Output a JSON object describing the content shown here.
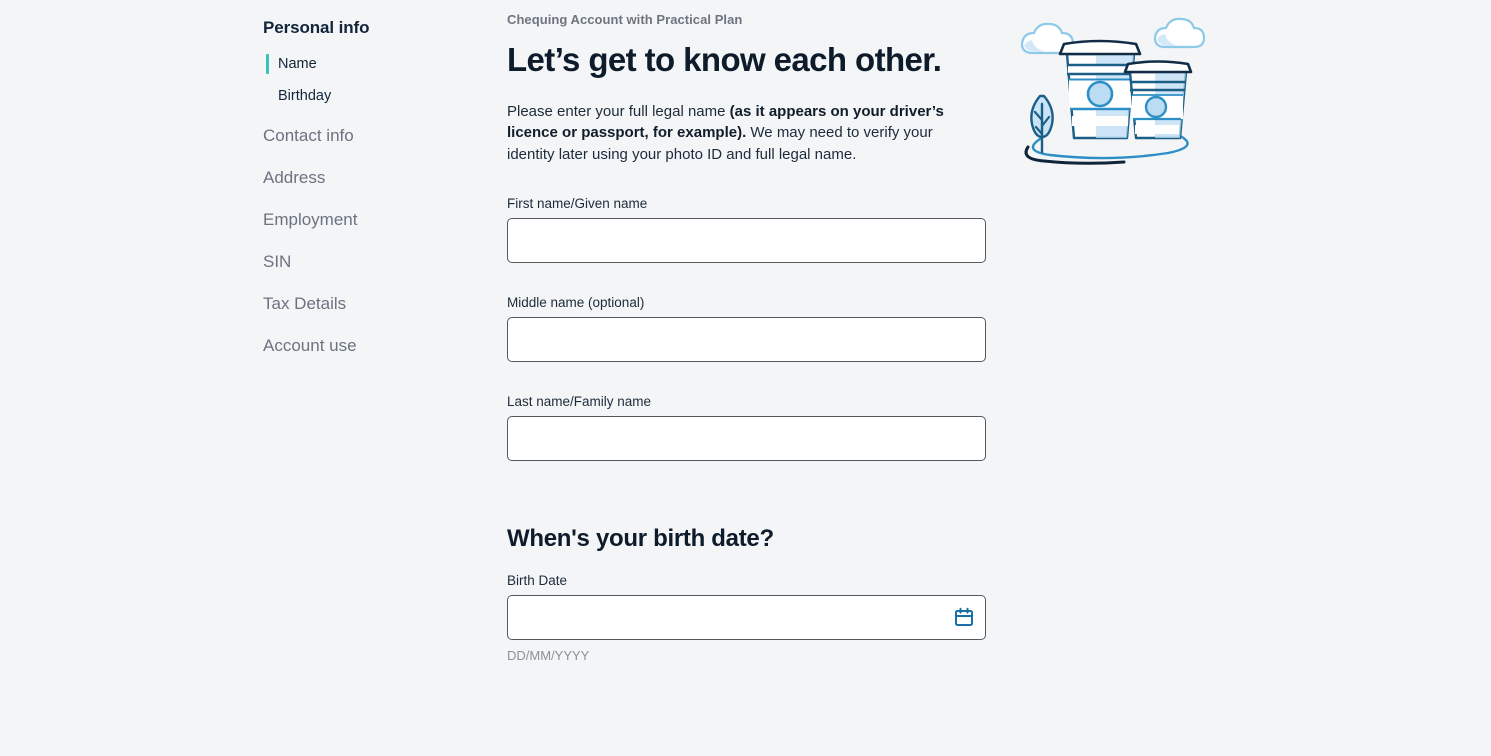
{
  "sidebar": {
    "heading": "Personal info",
    "sub_items": [
      {
        "label": "Name",
        "active": true
      },
      {
        "label": "Birthday",
        "active": false
      }
    ],
    "nav_items": [
      {
        "label": "Contact info"
      },
      {
        "label": "Address"
      },
      {
        "label": "Employment"
      },
      {
        "label": "SIN"
      },
      {
        "label": "Tax Details"
      },
      {
        "label": "Account use"
      }
    ]
  },
  "main": {
    "eyebrow": "Chequing Account with Practical Plan",
    "headline": "Let’s get to know each other.",
    "intro": {
      "part1": "Please enter your full legal name ",
      "bold": "(as it appears on your driver’s licence or passport, for example).",
      "part2": " We may need to verify your identity later using your photo ID and full legal name."
    },
    "fields": {
      "first_name": {
        "label": "First name/Given name",
        "value": "",
        "placeholder": ""
      },
      "middle_name": {
        "label": "Middle name (optional)",
        "value": "",
        "placeholder": ""
      },
      "last_name": {
        "label": "Last name/Family name",
        "value": "",
        "placeholder": ""
      }
    },
    "birth_section": {
      "title": "When's your birth date?",
      "label": "Birth Date",
      "value": "",
      "placeholder": "",
      "hint": "DD/MM/YYYY",
      "icon": "calendar-icon"
    }
  },
  "illustration": {
    "name": "coffee-cups-illustration",
    "elements": [
      "cloud-left",
      "cloud-right",
      "coffee-cup-large",
      "coffee-cup-small",
      "leaf",
      "ground-line"
    ]
  },
  "colors": {
    "background": "#f4f5f7",
    "heading": "#0d1b2a",
    "muted": "#6b7280",
    "accent_teal": "#3fc0b4",
    "accent_blue": "#1a6fa8",
    "input_border": "#53595f",
    "hint": "#8b9198"
  }
}
